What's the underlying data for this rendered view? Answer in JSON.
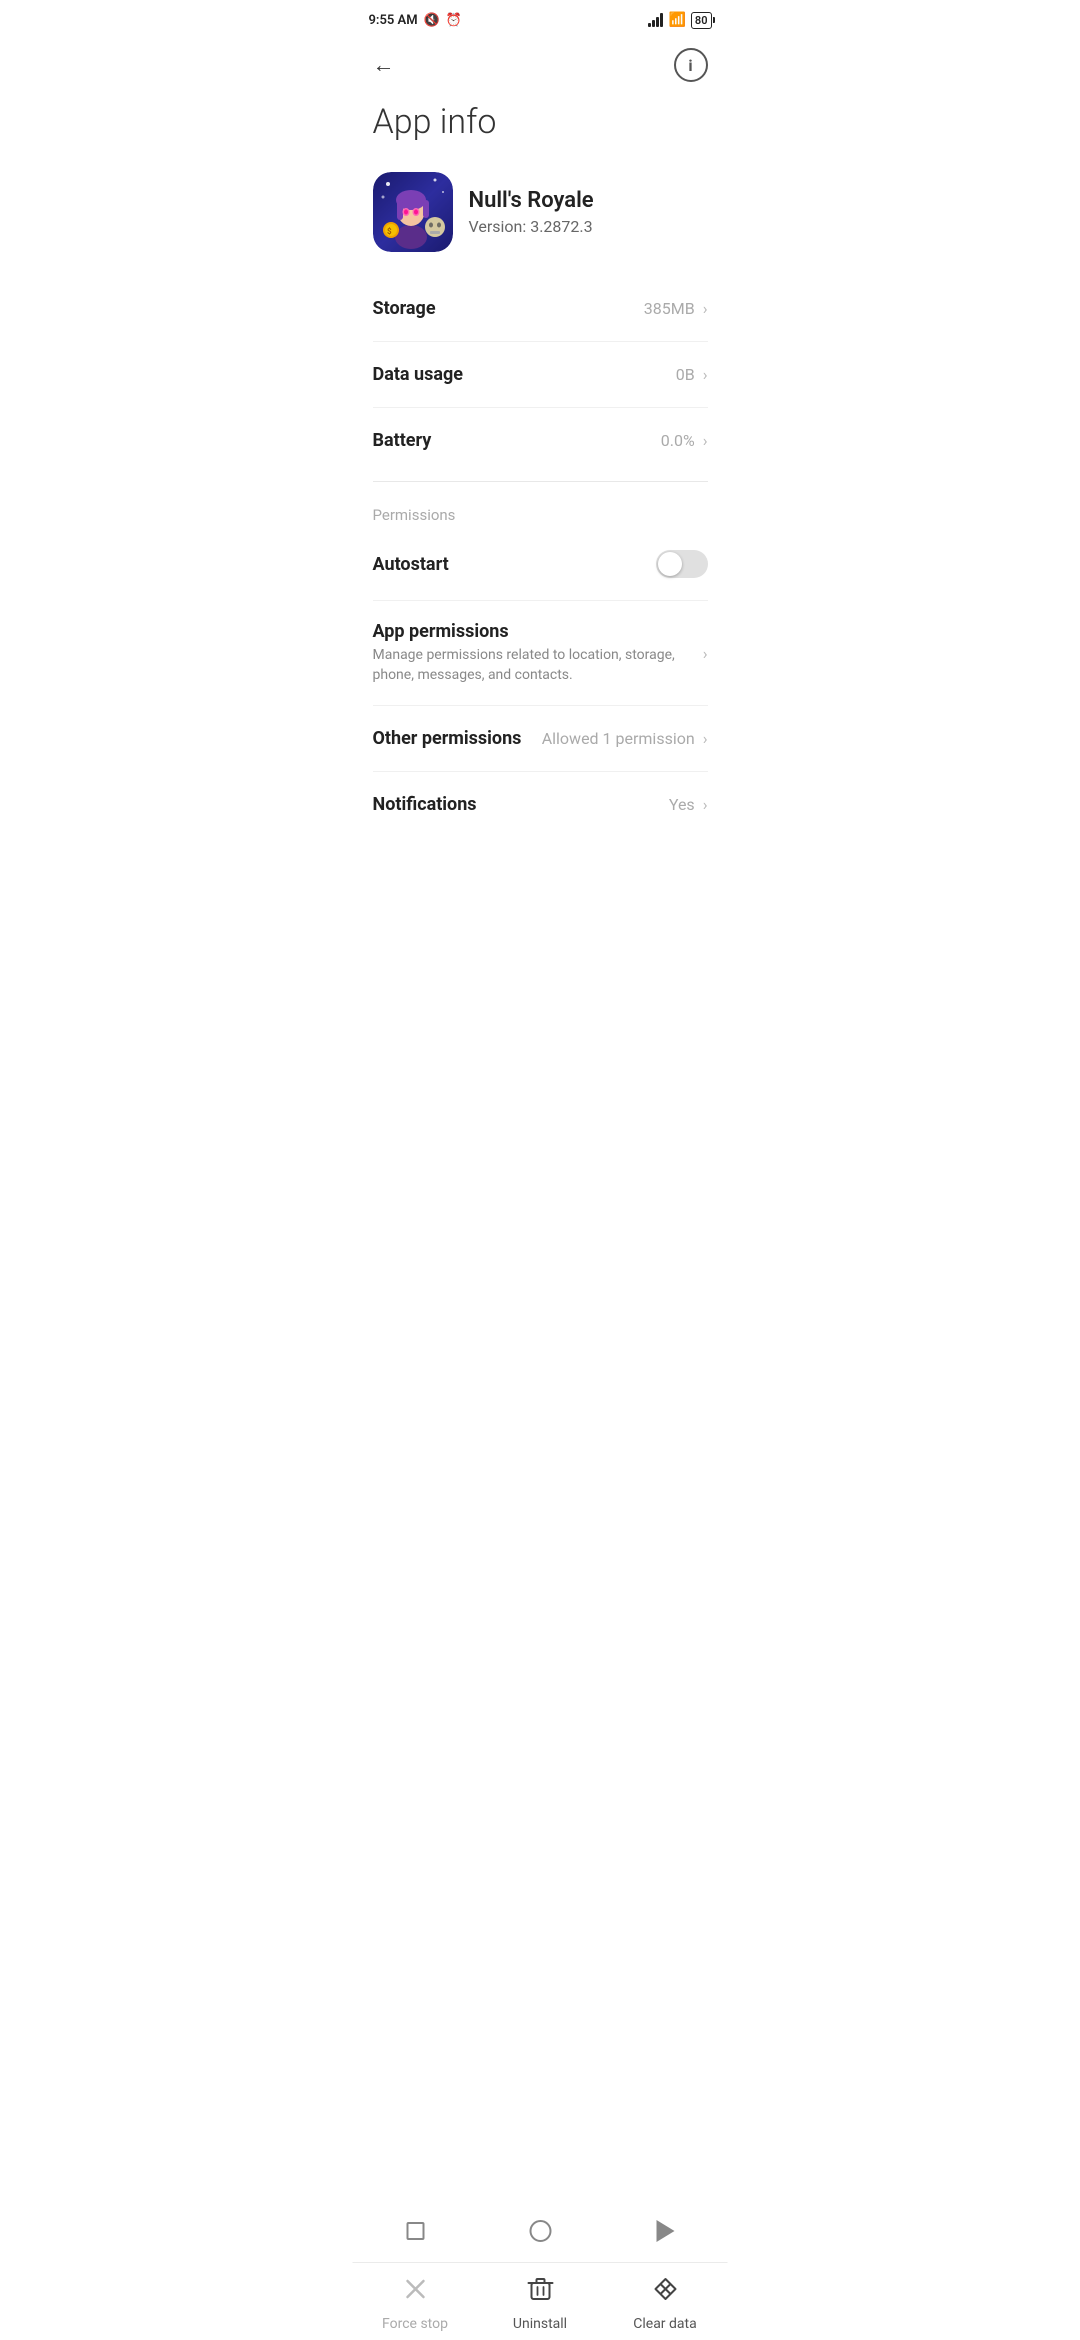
{
  "statusBar": {
    "time": "9:55 AM",
    "battery": "80"
  },
  "nav": {
    "backLabel": "←",
    "infoLabel": "i"
  },
  "pageTitle": "App info",
  "app": {
    "name": "Null's Royale",
    "version": "Version: 3.2872.3"
  },
  "settings": {
    "storage": {
      "label": "Storage",
      "value": "385MB"
    },
    "dataUsage": {
      "label": "Data usage",
      "value": "0B"
    },
    "battery": {
      "label": "Battery",
      "value": "0.0%"
    }
  },
  "permissions": {
    "sectionLabel": "Permissions",
    "autostart": {
      "label": "Autostart"
    },
    "appPermissions": {
      "title": "App permissions",
      "description": "Manage permissions related to location, storage, phone, messages, and contacts."
    },
    "otherPermissions": {
      "label": "Other permissions",
      "value": "Allowed 1 permission"
    },
    "notifications": {
      "label": "Notifications",
      "value": "Yes"
    }
  },
  "actions": {
    "forceStop": "Force stop",
    "uninstall": "Uninstall",
    "clearData": "Clear data"
  }
}
